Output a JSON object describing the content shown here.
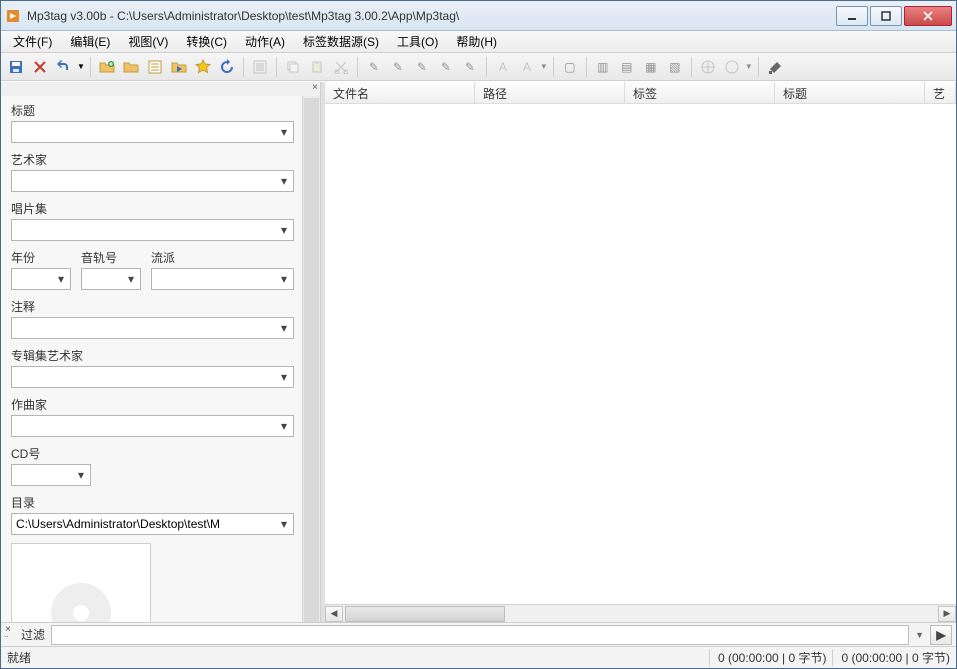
{
  "title": "Mp3tag v3.00b  -  C:\\Users\\Administrator\\Desktop\\test\\Mp3tag 3.00.2\\App\\Mp3tag\\",
  "menus": {
    "file": "文件(F)",
    "edit": "编辑(E)",
    "view": "视图(V)",
    "convert": "转换(C)",
    "actions": "动作(A)",
    "tagsources": "标签数据源(S)",
    "tools": "工具(O)",
    "help": "帮助(H)"
  },
  "fields": {
    "title": "标题",
    "artist": "艺术家",
    "album": "唱片集",
    "year": "年份",
    "track": "音轨号",
    "genre": "流派",
    "comment": "注释",
    "albumartist": "专辑集艺术家",
    "composer": "作曲家",
    "discno": "CD号",
    "directory": "目录",
    "directory_value": "C:\\Users\\Administrator\\Desktop\\test\\M"
  },
  "columns": {
    "filename": "文件名",
    "path": "路径",
    "tag": "标签",
    "title": "标题",
    "artist_short": "艺"
  },
  "filter": {
    "label": "过滤",
    "go": "▶"
  },
  "status": {
    "ready": "就绪",
    "seg1": "0 (00:00:00 | 0 字节)",
    "seg2": "0 (00:00:00 | 0 字节)"
  }
}
